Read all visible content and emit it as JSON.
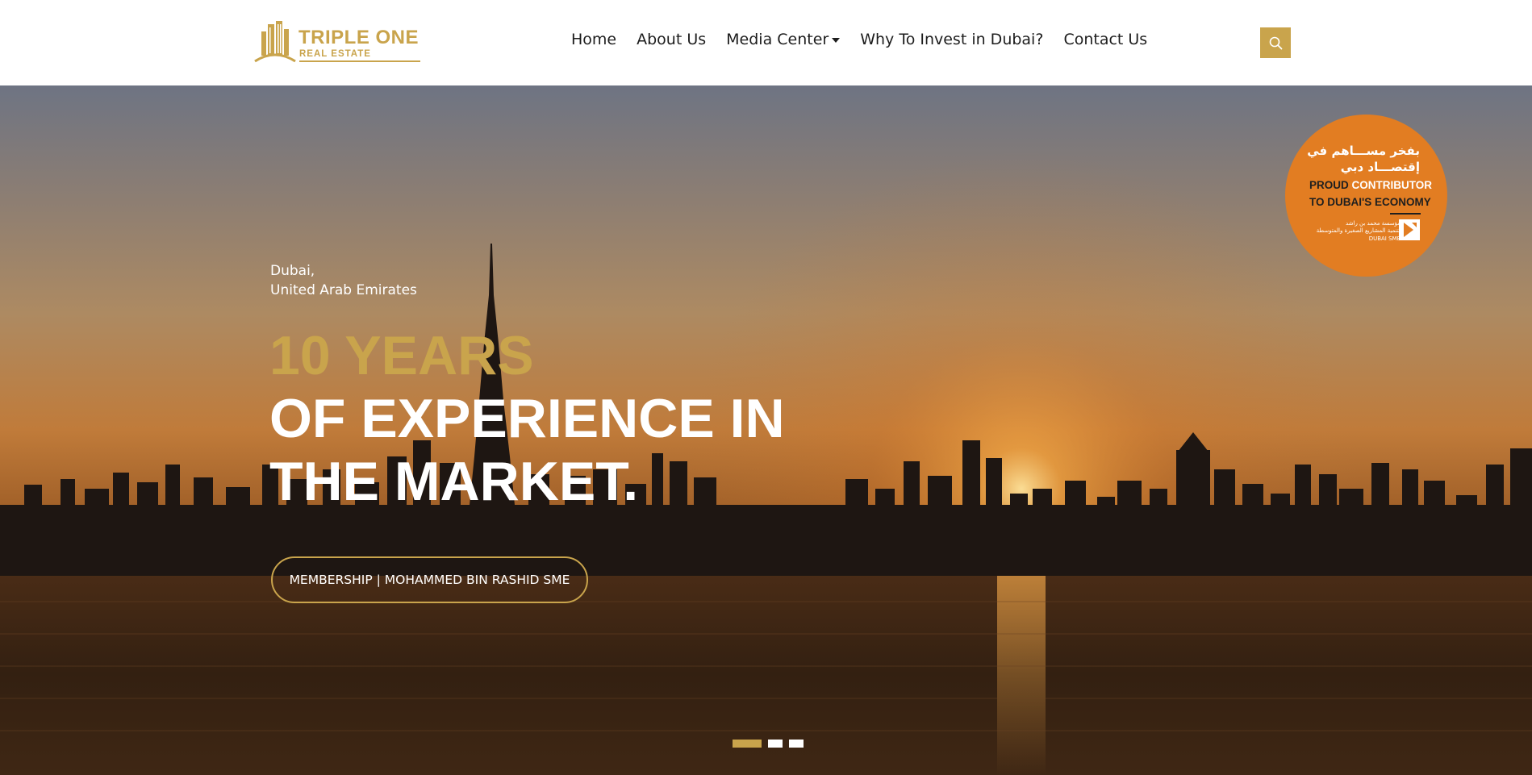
{
  "header": {
    "logo": {
      "name": "TRIPLE ONE",
      "subtitle": "REAL ESTATE"
    },
    "nav": [
      {
        "label": "Home"
      },
      {
        "label": "About Us"
      },
      {
        "label": "Media Center",
        "has_dropdown": true
      },
      {
        "label": "Why To Invest in Dubai?"
      },
      {
        "label": "Contact Us"
      }
    ],
    "search_icon": "search-icon"
  },
  "hero": {
    "location_line1": "Dubai,",
    "location_line2": "United Arab Emirates",
    "headline_accent": "10 YEARS",
    "headline_main": "OF EXPERIENCE IN THE MARKET.",
    "cta_label": "MEMBERSHIP | MOHAMMED BIN RASHID SME",
    "slider": {
      "count": 3,
      "active_index": 0
    }
  },
  "badge": {
    "arabic_line1": "بفخر مســـاهم في",
    "arabic_line2": "إقتصـــاد دبي",
    "english_proud": "PROUD",
    "english_contributor": "CONTRIBUTOR",
    "english_line2": "TO DUBAI'S ECONOMY",
    "small_line1": "مؤسسة محمد بن راشد",
    "small_line2": "لتنمية المشاريع الصغيرة والمتوسطة",
    "small_en": "DUBAI SME"
  },
  "colors": {
    "accent": "#c9a44c",
    "badge": "#e27d22",
    "nav_text": "#1d1d1d"
  }
}
